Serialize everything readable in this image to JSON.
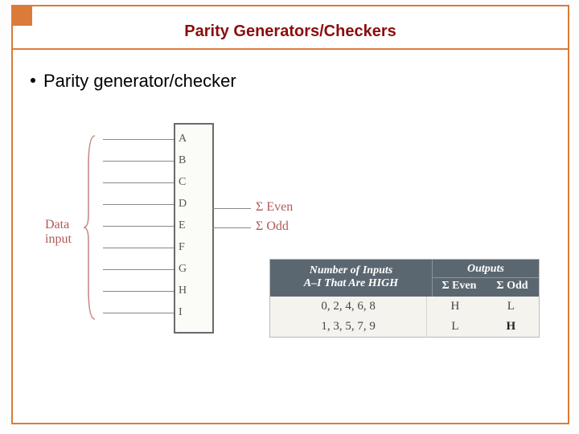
{
  "title": "Parity Generators/Checkers",
  "bullet": "Parity generator/checker",
  "figure": {
    "data_input_label": "Data\ninput",
    "inputs": [
      "A",
      "B",
      "C",
      "D",
      "E",
      "F",
      "G",
      "H",
      "I"
    ],
    "outputs": {
      "even": "Σ Even",
      "odd": "Σ Odd"
    }
  },
  "table": {
    "head_left_l1": "Number of Inputs",
    "head_left_l2": "A–I That Are HIGH",
    "head_right_top": "Outputs",
    "head_right_even": "Σ Even",
    "head_right_odd": "Σ Odd",
    "rows": [
      {
        "cond": "0, 2, 4, 6, 8",
        "even": "H",
        "odd": "L"
      },
      {
        "cond": "1, 3, 5, 7, 9",
        "even": "L",
        "odd": "H"
      }
    ]
  },
  "chart_data": [
    {
      "type": "table",
      "title": "Parity generator/checker truth table",
      "columns": [
        "Number of Inputs A–I That Are HIGH",
        "Σ Even",
        "Σ Odd"
      ],
      "rows": [
        [
          "0, 2, 4, 6, 8",
          "H",
          "L"
        ],
        [
          "1, 3, 5, 7, 9",
          "L",
          "H"
        ]
      ]
    }
  ]
}
